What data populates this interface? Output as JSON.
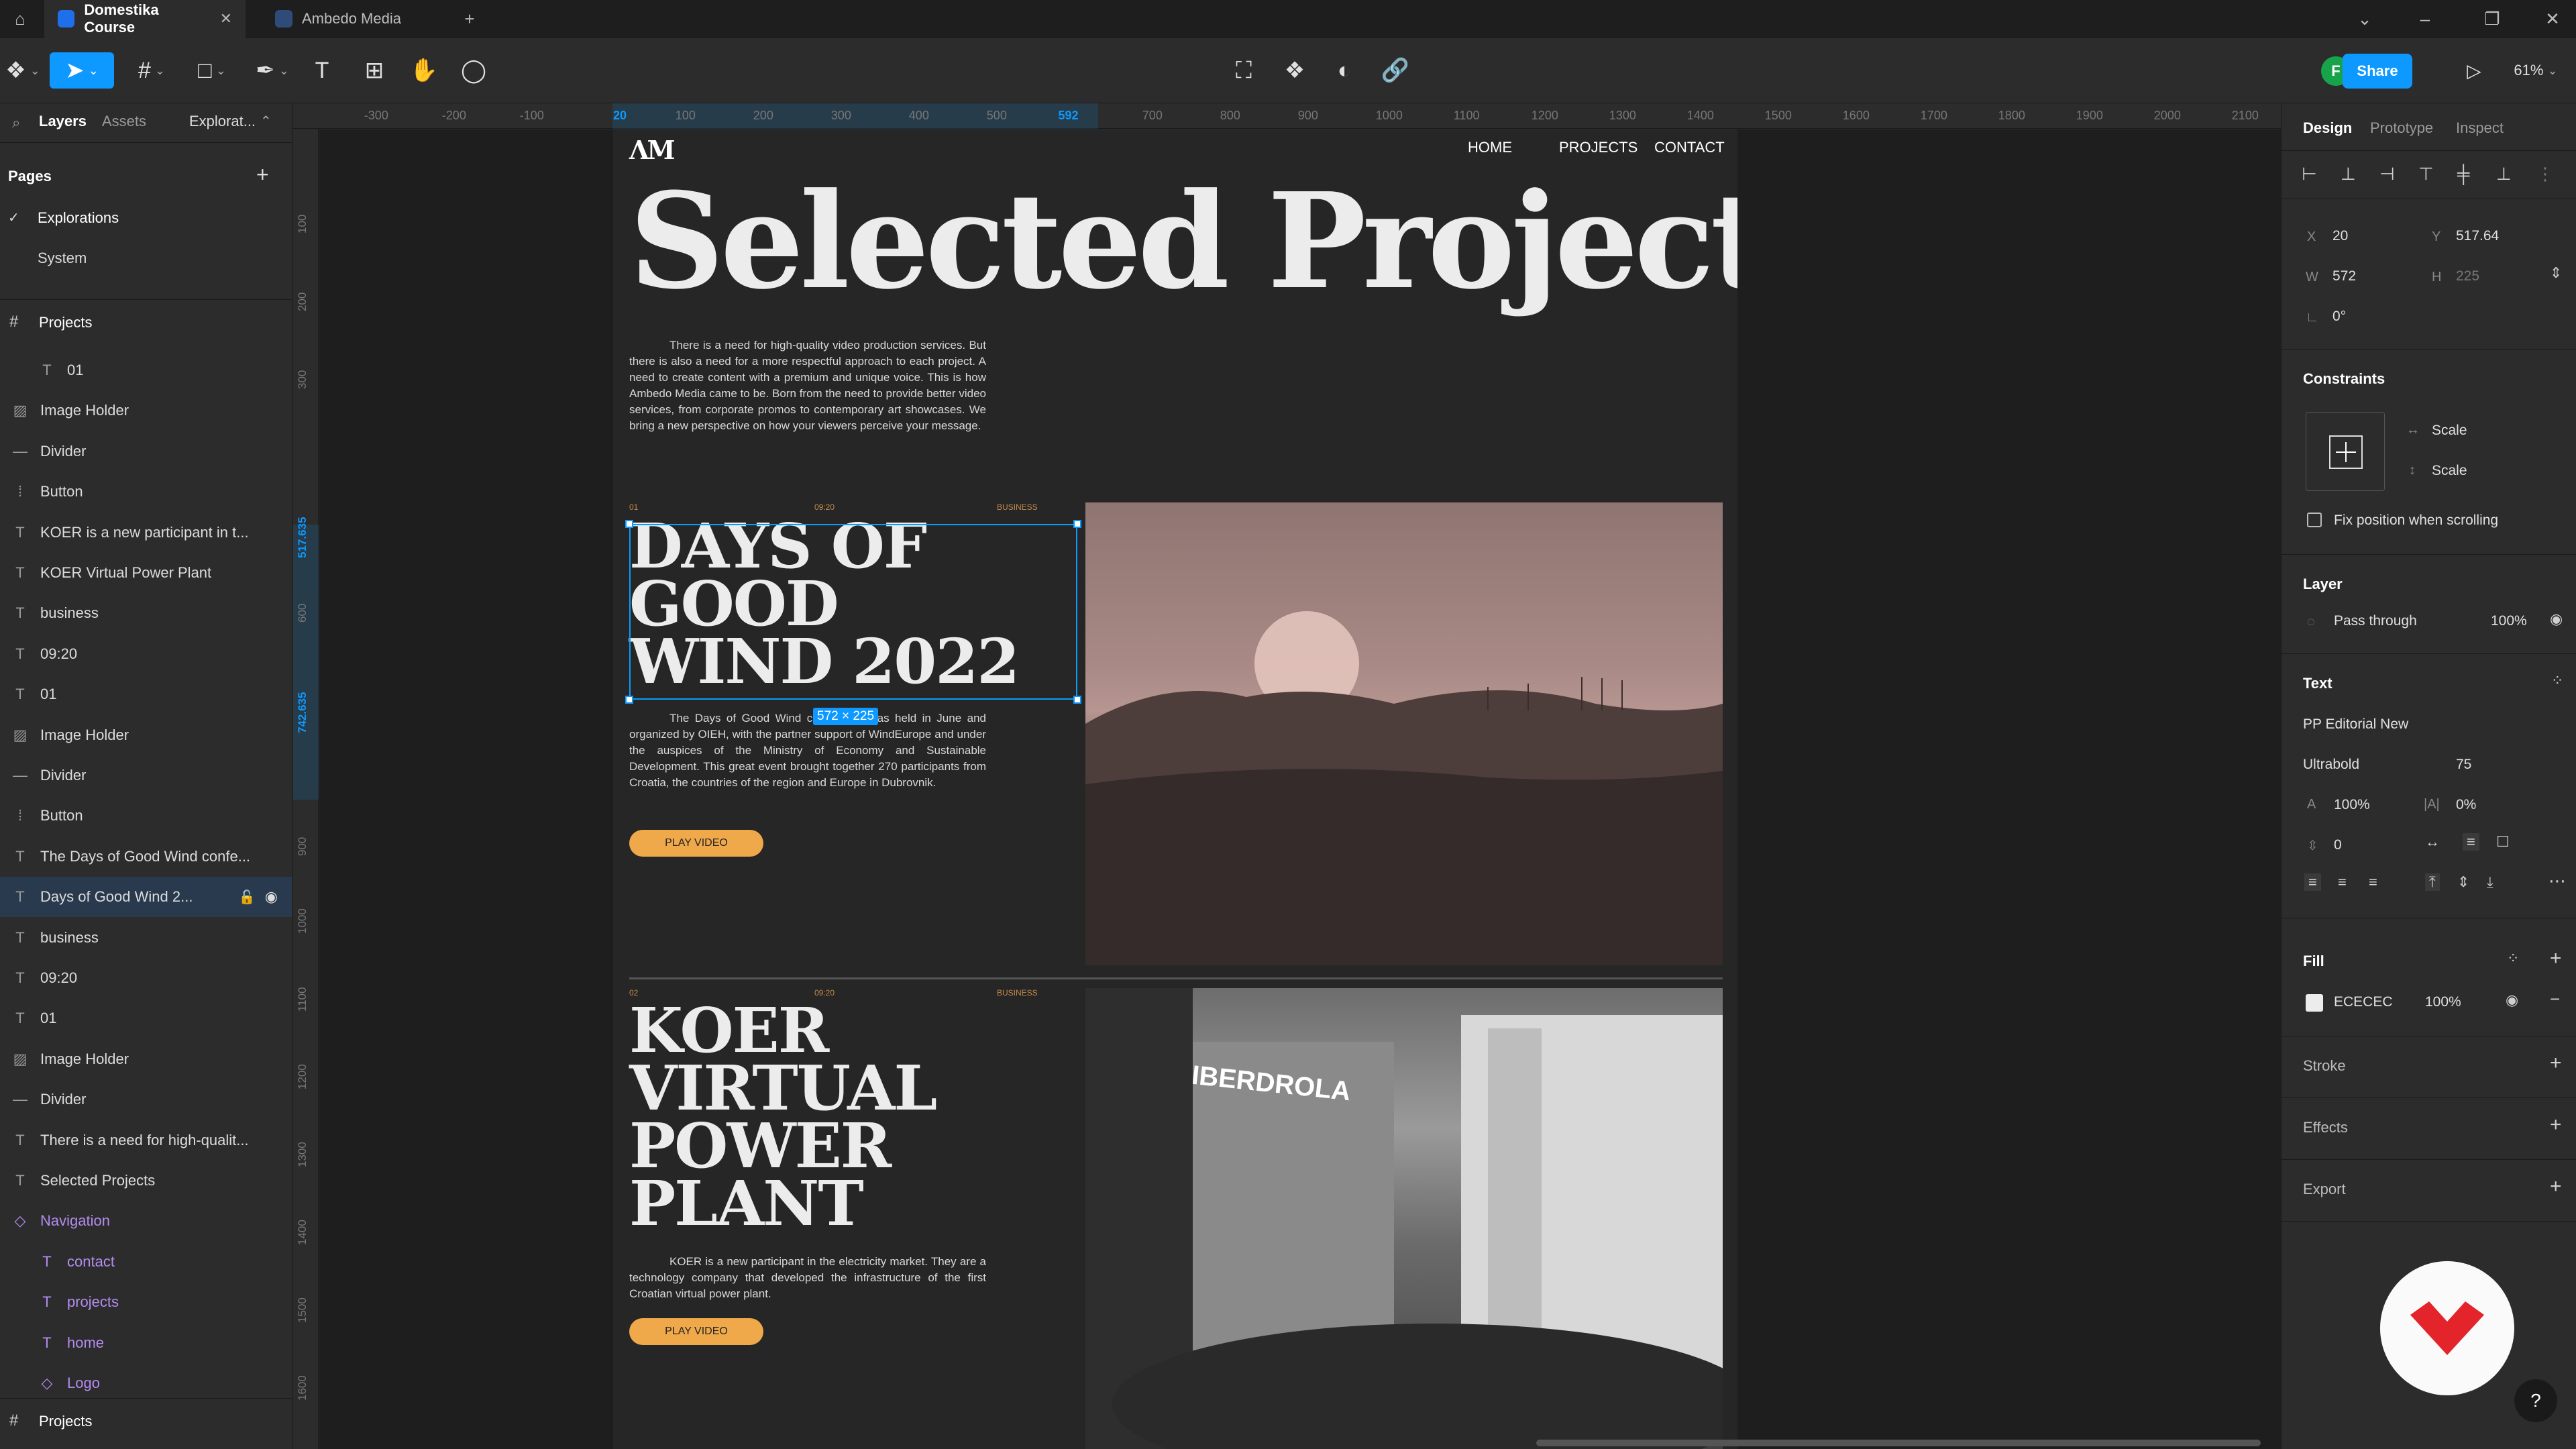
{
  "tabs": [
    {
      "label": "Domestika Course"
    },
    {
      "label": "Ambedo Media"
    }
  ],
  "toolbar": {
    "share_label": "Share",
    "zoom": "61%",
    "avatar_initial": "F"
  },
  "left_panel": {
    "tab_layers": "Layers",
    "tab_assets": "Assets",
    "tab_page": "Explorat...",
    "pages_heading": "Pages",
    "pages": [
      "Explorations",
      "System"
    ],
    "frame_name": "Projects",
    "layers": [
      {
        "type": "text",
        "name": "01"
      },
      {
        "type": "image",
        "name": "Image Holder"
      },
      {
        "type": "divider",
        "name": "Divider"
      },
      {
        "type": "component",
        "name": "Button"
      },
      {
        "type": "text",
        "name": "KOER is a new participant in t..."
      },
      {
        "type": "text",
        "name": "KOER Virtual Power Plant"
      },
      {
        "type": "text",
        "name": "business"
      },
      {
        "type": "text",
        "name": "09:20"
      },
      {
        "type": "text",
        "name": "01"
      },
      {
        "type": "image",
        "name": "Image Holder"
      },
      {
        "type": "divider",
        "name": "Divider"
      },
      {
        "type": "component",
        "name": "Button"
      },
      {
        "type": "text",
        "name": "The Days of Good Wind confe..."
      },
      {
        "type": "text",
        "name": "Days of Good Wind 2..."
      },
      {
        "type": "text",
        "name": "business"
      },
      {
        "type": "text",
        "name": "09:20"
      },
      {
        "type": "text",
        "name": "01"
      },
      {
        "type": "image",
        "name": "Image Holder"
      },
      {
        "type": "divider",
        "name": "Divider"
      },
      {
        "type": "text",
        "name": "There is a need for high-qualit..."
      },
      {
        "type": "text",
        "name": "Selected Projects"
      },
      {
        "type": "instance",
        "name": "Navigation"
      },
      {
        "type": "text",
        "name": "contact"
      },
      {
        "type": "text",
        "name": "projects"
      },
      {
        "type": "text",
        "name": "home"
      },
      {
        "type": "instance",
        "name": "Logo"
      }
    ],
    "bottom_frame": "Projects"
  },
  "rulers": {
    "top": [
      "-300",
      "-200",
      "-100",
      "20",
      "100",
      "200",
      "300",
      "400",
      "500",
      "592",
      "700",
      "800",
      "900",
      "1000",
      "1100",
      "1200",
      "1300",
      "1400",
      "1500",
      "1600",
      "1700",
      "1800",
      "1900",
      "2000",
      "2100"
    ],
    "left": [
      "100",
      "200",
      "300",
      "517.635",
      "600",
      "742.635",
      "900",
      "1000",
      "1100",
      "1200",
      "1300",
      "1400",
      "1500",
      "1600"
    ]
  },
  "design": {
    "logo": "ΛM",
    "nav": [
      "HOME",
      "PROJECTS",
      "CONTACT"
    ],
    "hero": "Selected Projects",
    "intro": "There is a need for high-quality video production services. But there is also a need for a more respectful approach to each project. A need to create content with a premium and unique voice. This is how Ambedo Media came to be. Born from the need to provide better video services, from corporate promos to contemporary art showcases. We bring a new perspective on how your viewers perceive your message.",
    "project1": {
      "num": "01",
      "time": "09:20",
      "cat": "BUSINESS",
      "title": "DAYS OF GOOD WIND 2022",
      "desc": "The Days of Good Wind conference was held in June and organized by OIEH, with the partner support of WindEurope and under the auspices of the Ministry of Economy and Sustainable Development. This great event brought together 270 participants from Croatia, the countries of the region and Europe in Dubrovnik.",
      "button": "PLAY VIDEO"
    },
    "project2": {
      "num": "02",
      "time": "09:20",
      "cat": "BUSINESS",
      "title": "KOER VIRTUAL POWER PLANT",
      "desc": "KOER is a new participant in the electricity market. They are a technology company that developed the infrastructure of the first Croatian virtual power plant.",
      "button": "PLAY VIDEO"
    },
    "size_badge": "572 × 225",
    "booth_sign": "IBERDROLA"
  },
  "right_panel": {
    "tabs": [
      "Design",
      "Prototype",
      "Inspect"
    ],
    "x_label": "X",
    "x": "20",
    "y_label": "Y",
    "y": "517.64",
    "w_label": "W",
    "w": "572",
    "h_label": "H",
    "h": "225",
    "rotation": "0°",
    "constraints_heading": "Constraints",
    "constraint_h": "Scale",
    "constraint_v": "Scale",
    "fix_position": "Fix position when scrolling",
    "layer_heading": "Layer",
    "blend": "Pass through",
    "opacity": "100%",
    "text_heading": "Text",
    "font_family": "PP Editorial New",
    "font_weight": "Ultrabold",
    "font_size": "75",
    "line_height": "100%",
    "letter_spacing": "0%",
    "paragraph_spacing": "0",
    "fill_heading": "Fill",
    "fill_hex": "ECECEC",
    "fill_opacity": "100%",
    "stroke_heading": "Stroke",
    "effects_heading": "Effects",
    "export_heading": "Export"
  },
  "colors": {
    "accent": "#0d99ff",
    "button": "#f0a94a",
    "fill": "#ECECEC"
  }
}
